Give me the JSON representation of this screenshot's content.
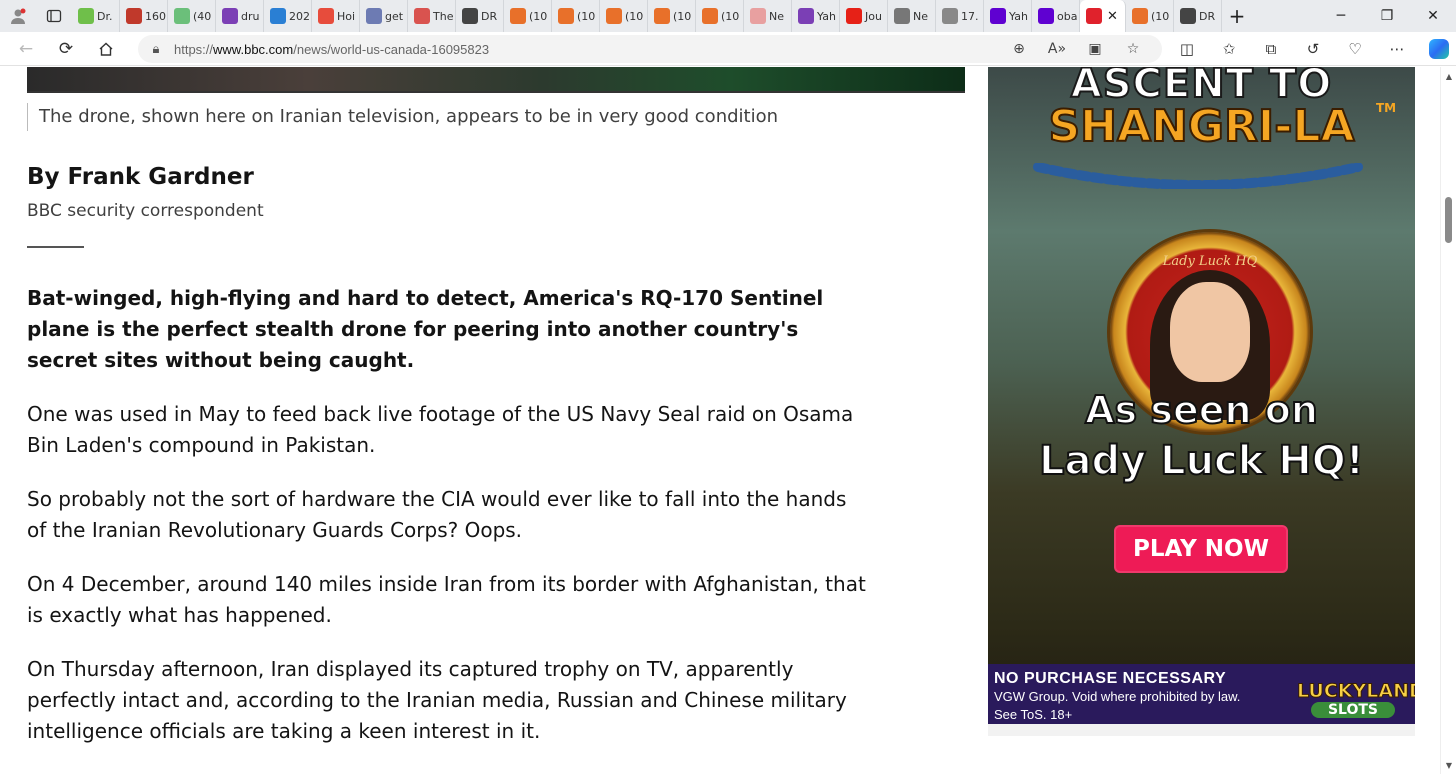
{
  "tabs": [
    {
      "label": "Dr.",
      "icon": "play-icon",
      "color": "#6fbf4a"
    },
    {
      "label": "160",
      "icon": "bi-icon",
      "color": "#c0392b"
    },
    {
      "label": "(40",
      "icon": "g-icon",
      "color": "#6bbf7a"
    },
    {
      "label": "dru",
      "icon": "yahoo-icon",
      "color": "#7b3fb5"
    },
    {
      "label": "202",
      "icon": "p-icon",
      "color": "#2a7fd4"
    },
    {
      "label": "Hoi",
      "icon": "red-square-icon",
      "color": "#e74c3c"
    },
    {
      "label": "get",
      "icon": "search-icon",
      "color": "#6d7bb3"
    },
    {
      "label": "The",
      "icon": "dm-icon",
      "color": "#d9534f"
    },
    {
      "label": "DR",
      "icon": "drudge-icon",
      "color": "#444444"
    },
    {
      "label": "(10",
      "icon": "bookmark-icon",
      "color": "#e8702a"
    },
    {
      "label": "(10",
      "icon": "bookmark-icon",
      "color": "#e8702a"
    },
    {
      "label": "(10",
      "icon": "bookmark-icon",
      "color": "#e8702a"
    },
    {
      "label": "(10",
      "icon": "bookmark-icon",
      "color": "#e8702a"
    },
    {
      "label": "(10",
      "icon": "bookmark-icon",
      "color": "#e8702a"
    },
    {
      "label": "Ne",
      "icon": "r-icon",
      "color": "#e8a0a0"
    },
    {
      "label": "Yah",
      "icon": "yahoo-icon",
      "color": "#7b3fb5"
    },
    {
      "label": "Jou",
      "icon": "youtube-icon",
      "color": "#e62117"
    },
    {
      "label": "Ne",
      "icon": "news-icon",
      "color": "#777777"
    },
    {
      "label": "17.",
      "icon": "doc-icon",
      "color": "#888888"
    },
    {
      "label": "Yah",
      "icon": "yahoo-icon",
      "color": "#5f01d1"
    },
    {
      "label": "oba",
      "icon": "yahoo-icon",
      "color": "#5f01d1"
    }
  ],
  "active_tab": {
    "icon": "red-cross-icon",
    "color": "#e0222c",
    "close": "✕"
  },
  "trailing_tabs": [
    {
      "label": "(10",
      "icon": "bookmark-icon",
      "color": "#e8702a"
    },
    {
      "label": "DR",
      "icon": "drudge-icon",
      "color": "#444444"
    }
  ],
  "address": {
    "url_prefix": "https://",
    "url_host": "www.bbc.com",
    "url_path": "/news/world-us-canada-16095823"
  },
  "article": {
    "caption": "The drone, shown here on Iranian television, appears to be in very good condition",
    "byline_name": "By Frank Gardner",
    "byline_role": "BBC security correspondent",
    "paragraphs": [
      "Bat-winged, high-flying and hard to detect, America's RQ-170 Sentinel plane is the perfect stealth drone for peering into another country's secret sites without being caught.",
      "One was used in May to feed back live footage of the US Navy Seal raid on Osama Bin Laden's compound in Pakistan.",
      "So probably not the sort of hardware the CIA would ever like to fall into the hands of the Iranian Revolutionary Guards Corps? Oops.",
      "On 4 December, around 140 miles inside Iran from its border with Afghanistan, that is exactly what has happened.",
      "On Thursday afternoon, Iran displayed its captured trophy on TV, apparently perfectly intact and, according to the Iranian media, Russian and Chinese military intelligence officials are taking a keen interest in it."
    ]
  },
  "ad": {
    "title_line1": "ASCENT TO",
    "title_line2": "SHANGRI-LA",
    "tm": "TM",
    "medal_text": "Lady Luck HQ",
    "seen_line1": "As seen on",
    "seen_line2": "Lady Luck HQ!",
    "cta": "PLAY NOW",
    "footer_line1": "NO PURCHASE NECESSARY",
    "footer_line2": "VGW Group. Void where prohibited by law.",
    "footer_line3": "See ToS. 18+",
    "logo_line1": "LUCKYLAND",
    "logo_line2": "SLOTS",
    "colors": {
      "cta": "#ee1b56",
      "footer": "#2a1a5c",
      "title": "#f5a623"
    }
  }
}
